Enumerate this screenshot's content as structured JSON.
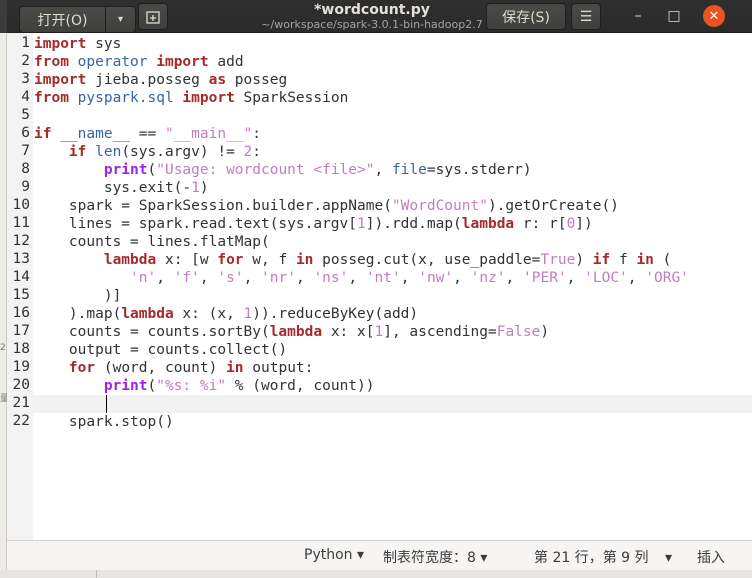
{
  "header": {
    "open_label": "打开(O)",
    "open_arrow": "▾",
    "new_tab_icon": "new-tab-icon",
    "title": "*wordcount.py",
    "subtitle": "~/workspace/spark-3.0.1-bin-hadoop2.7",
    "save_label": "保存(S)",
    "menu_icon": "☰",
    "minimize_icon": "–",
    "maximize_icon": "□",
    "close_icon": "✕"
  },
  "editor": {
    "line_numbers": [
      "1",
      "2",
      "3",
      "4",
      "5",
      "6",
      "7",
      "8",
      "9",
      "10",
      "11",
      "12",
      "13",
      "14",
      "15",
      "16",
      "17",
      "18",
      "19",
      "20",
      "21",
      "22"
    ],
    "current_line": 21
  },
  "left_strip": {
    "marks": [
      "2",
      "量"
    ]
  },
  "statusbar": {
    "language": "Python",
    "language_arrow": "▾",
    "tab_width": "制表符宽度：8",
    "tab_arrow": "▾",
    "position": "第 21 行，第 9 列",
    "position_arrow": "▾",
    "insert_mode": "插入"
  }
}
